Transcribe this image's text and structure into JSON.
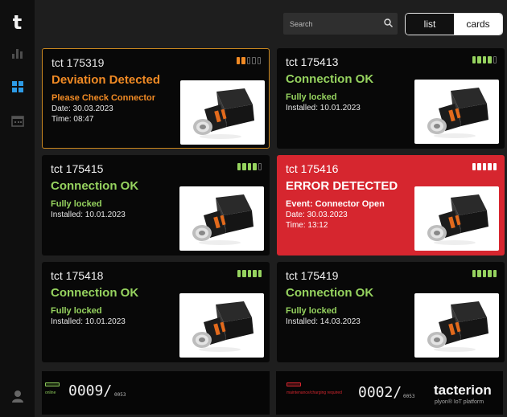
{
  "sidebar": {
    "logo": "t",
    "icons": [
      "chart-icon",
      "grid-icon",
      "calendar-icon",
      "user-icon"
    ]
  },
  "search": {
    "placeholder": "Search"
  },
  "view_toggle": {
    "list": "list",
    "cards": "cards",
    "active": "cards"
  },
  "colors": {
    "ok": "#96d35f",
    "warning": "#f08a24",
    "error": "#d6262f",
    "background": "#1e1e1e",
    "card": "#080808"
  },
  "cards": [
    {
      "id": "tct 175319",
      "status": "Deviation Detected",
      "sub": "Please Check Connector",
      "line1": "Date: 30.03.2023",
      "line2": "Time: 08:47",
      "level": 2,
      "state": "warning"
    },
    {
      "id": "tct 175413",
      "status": "Connection OK",
      "sub": "Fully locked",
      "line1": "Installed: 10.01.2023",
      "line2": "",
      "level": 4,
      "state": "ok"
    },
    {
      "id": "tct 175415",
      "status": "Connection OK",
      "sub": "Fully locked",
      "line1": "Installed: 10.01.2023",
      "line2": "",
      "level": 4,
      "state": "ok"
    },
    {
      "id": "tct 175416",
      "status": "ERROR DETECTED",
      "sub": "Event: Connector Open",
      "line1": "Date: 30.03.2023",
      "line2": "Time: 13:12",
      "level": 5,
      "state": "error"
    },
    {
      "id": "tct 175418",
      "status": "Connection OK",
      "sub": "Fully locked",
      "line1": "Installed: 10.01.2023",
      "line2": "",
      "level": 5,
      "state": "ok"
    },
    {
      "id": "tct 175419",
      "status": "Connection OK",
      "sub": "Fully locked",
      "line1": "Installed: 14.03.2023",
      "line2": "",
      "level": 5,
      "state": "ok"
    }
  ],
  "footer": {
    "online_label": "online",
    "online_count": "0009",
    "online_total": "/",
    "online_total_num": "0053",
    "maint_label": "maintenance/charging required",
    "maint_count": "0002",
    "maint_total": "/",
    "maint_total_num": "0053",
    "brand": "tacterion",
    "brand_sub": "plyon® IoT platform"
  }
}
